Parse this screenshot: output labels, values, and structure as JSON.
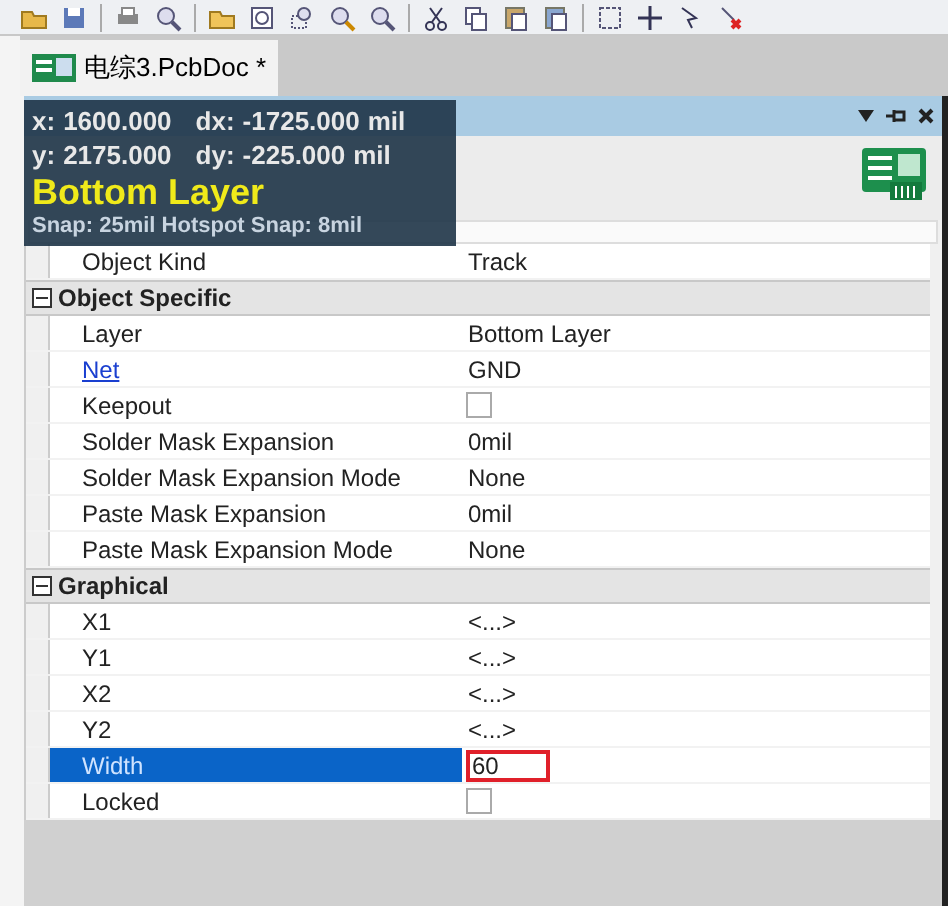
{
  "document_tab": {
    "label": "电综3.PcbDoc *",
    "selected": true
  },
  "overlay": {
    "lines": [
      [
        "x:",
        "1600.000",
        "dx:",
        "-1725.000",
        "mil"
      ],
      [
        "y:",
        "2175.000",
        "dy:",
        "-225.000",
        "mil"
      ]
    ],
    "layer": "Bottom Layer",
    "snap": "Snap: 25mil Hotspot Snap: 8mil"
  },
  "properties": {
    "top_rows": [
      {
        "label": "Object Kind",
        "value": "Track",
        "kind": "text",
        "selected": false
      }
    ],
    "sections": [
      {
        "title": "Object Specific",
        "expanded": true,
        "rows": [
          {
            "label": "Layer",
            "value": "Bottom Layer",
            "kind": "text",
            "selected": false
          },
          {
            "label": "Net",
            "value": "GND",
            "kind": "link",
            "selected": false
          },
          {
            "label": "Keepout",
            "kind": "checkbox",
            "checked": false,
            "selected": false
          },
          {
            "label": "Solder Mask Expansion",
            "value": "0mil",
            "kind": "text",
            "selected": false
          },
          {
            "label": "Solder Mask Expansion Mode",
            "value": "None",
            "kind": "text",
            "selected": false
          },
          {
            "label": "Paste Mask Expansion",
            "value": "0mil",
            "kind": "text",
            "selected": false
          },
          {
            "label": "Paste Mask Expansion Mode",
            "value": "None",
            "kind": "text",
            "selected": false
          }
        ]
      },
      {
        "title": "Graphical",
        "expanded": true,
        "rows": [
          {
            "label": "X1",
            "value": "<...>",
            "kind": "text",
            "selected": false
          },
          {
            "label": "Y1",
            "value": "<...>",
            "kind": "text",
            "selected": false
          },
          {
            "label": "X2",
            "value": "<...>",
            "kind": "text",
            "selected": false
          },
          {
            "label": "Y2",
            "value": "<...>",
            "kind": "text",
            "selected": false
          },
          {
            "label": "Width",
            "value": "60",
            "kind": "text",
            "selected": true,
            "highlighted": true
          },
          {
            "label": "Locked",
            "kind": "checkbox",
            "checked": false,
            "selected": false
          }
        ]
      }
    ]
  }
}
